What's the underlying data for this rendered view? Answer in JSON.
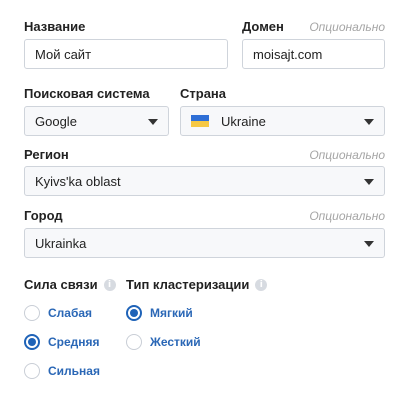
{
  "name_field": {
    "label": "Название",
    "value": "Мой сайт"
  },
  "domain_field": {
    "label": "Домен",
    "optional": "Опционально",
    "value": "moisajt.com"
  },
  "search_engine": {
    "label": "Поисковая система",
    "value": "Google"
  },
  "country": {
    "label": "Страна",
    "value": "Ukraine",
    "flag_icon": "ukraine-flag-icon"
  },
  "region": {
    "label": "Регион",
    "optional": "Опционально",
    "value": "Kyivs'ka oblast"
  },
  "city": {
    "label": "Город",
    "optional": "Опционально",
    "value": "Ukrainka"
  },
  "link_strength": {
    "title": "Сила связи",
    "options": [
      {
        "label": "Слабая",
        "checked": false
      },
      {
        "label": "Средняя",
        "checked": true
      },
      {
        "label": "Сильная",
        "checked": false
      }
    ]
  },
  "clustering_type": {
    "title": "Тип кластеризации",
    "options": [
      {
        "label": "Мягкий",
        "checked": true
      },
      {
        "label": "Жесткий",
        "checked": false
      }
    ]
  },
  "colors": {
    "accent": "#1f63b8",
    "border": "#cfd4db",
    "flag_blue": "#2f6fd6",
    "flag_yellow": "#f6c844"
  }
}
